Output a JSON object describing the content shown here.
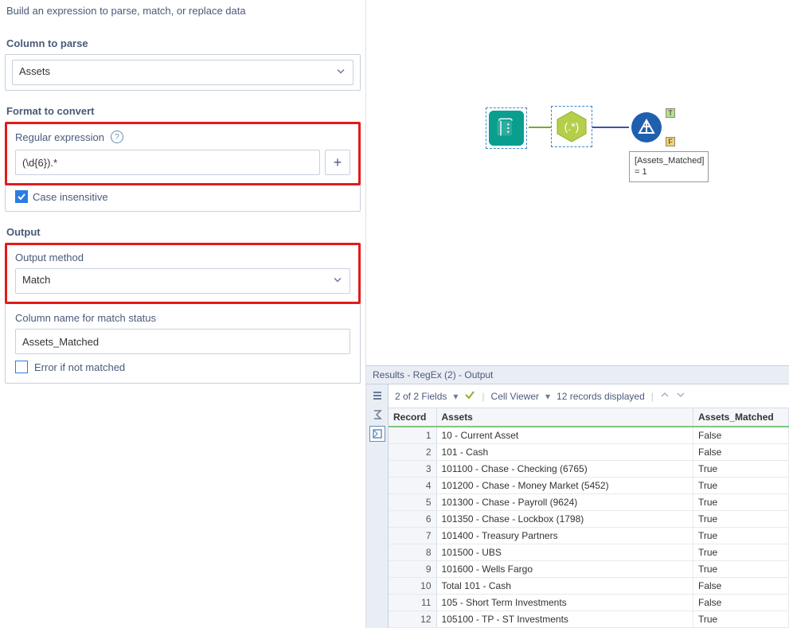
{
  "left": {
    "description": "Build an expression to parse, match, or replace data",
    "column_to_parse": {
      "label": "Column to parse",
      "value": "Assets"
    },
    "format_to_convert": {
      "label": "Format to convert"
    },
    "regex": {
      "label": "Regular expression",
      "value": "(\\d{6}).*",
      "case_insensitive_label": "Case insensitive"
    },
    "output_header": "Output",
    "output_method": {
      "label": "Output method",
      "value": "Match"
    },
    "match_col": {
      "label": "Column name for match status",
      "value": "Assets_Matched"
    },
    "error_not_matched_label": "Error if not matched"
  },
  "canvas": {
    "annotation": "[Assets_Matched] = 1"
  },
  "results": {
    "title": "Results - RegEx (2) - Output",
    "fields_text": "2 of 2 Fields",
    "cell_viewer_label": "Cell Viewer",
    "records_text": "12 records displayed",
    "columns": [
      "Record",
      "Assets",
      "Assets_Matched"
    ],
    "rows": [
      {
        "n": 1,
        "assets": "10 - Current Asset",
        "matched": "False"
      },
      {
        "n": 2,
        "assets": "101 - Cash",
        "matched": "False"
      },
      {
        "n": 3,
        "assets": "101100 - Chase - Checking (6765)",
        "matched": "True"
      },
      {
        "n": 4,
        "assets": "101200 - Chase - Money Market (5452)",
        "matched": "True"
      },
      {
        "n": 5,
        "assets": "101300 - Chase - Payroll (9624)",
        "matched": "True"
      },
      {
        "n": 6,
        "assets": "101350 - Chase - Lockbox (1798)",
        "matched": "True"
      },
      {
        "n": 7,
        "assets": "101400 - Treasury Partners",
        "matched": "True"
      },
      {
        "n": 8,
        "assets": "101500 - UBS",
        "matched": "True"
      },
      {
        "n": 9,
        "assets": "101600 - Wells Fargo",
        "matched": "True"
      },
      {
        "n": 10,
        "assets": "Total 101 - Cash",
        "matched": "False"
      },
      {
        "n": 11,
        "assets": "105 - Short Term Investments",
        "matched": "False"
      },
      {
        "n": 12,
        "assets": "105100 - TP - ST Investments",
        "matched": "True"
      }
    ]
  }
}
